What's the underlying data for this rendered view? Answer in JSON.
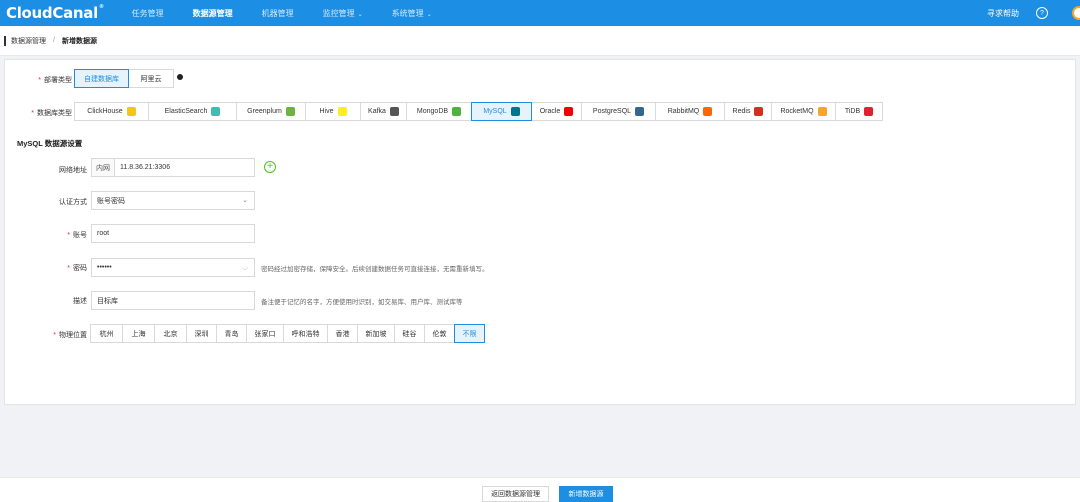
{
  "app": {
    "logo": "CloudCanal",
    "logo_mark": "®"
  },
  "nav": {
    "items": [
      {
        "label": "任务管理",
        "active": false,
        "caret": ""
      },
      {
        "label": "数据源管理",
        "active": true,
        "caret": ""
      },
      {
        "label": "机器管理",
        "active": false,
        "caret": ""
      },
      {
        "label": "监控管理",
        "active": false,
        "caret": "⌄"
      },
      {
        "label": "系统管理",
        "active": false,
        "caret": "⌄"
      }
    ],
    "help": "寻求帮助",
    "help_icon": "?"
  },
  "breadcrumb": {
    "parent": "数据源管理",
    "separator": "/",
    "current": "新增数据源"
  },
  "form": {
    "deploy": {
      "label": "部署类型",
      "options": [
        "自建数据库",
        "阿里云"
      ],
      "selected": "自建数据库"
    },
    "dbtype": {
      "label": "数据库类型",
      "options": [
        {
          "name": "ClickHouse",
          "icon": "clickhouse-icon",
          "color": "#f5c518"
        },
        {
          "name": "ElasticSearch",
          "icon": "elasticsearch-icon",
          "color": "#3ebeb0"
        },
        {
          "name": "Greenplum",
          "icon": "greenplum-icon",
          "color": "#6db33f"
        },
        {
          "name": "Hive",
          "icon": "hive-icon",
          "color": "#fdee21"
        },
        {
          "name": "Kafka",
          "icon": "kafka-icon",
          "color": "#555555"
        },
        {
          "name": "MongoDB",
          "icon": "mongodb-icon",
          "color": "#4db33d"
        },
        {
          "name": "MySQL",
          "icon": "mysql-icon",
          "color": "#00758f"
        },
        {
          "name": "Oracle",
          "icon": "oracle-icon",
          "color": "#f80000"
        },
        {
          "name": "PostgreSQL",
          "icon": "postgresql-icon",
          "color": "#336791"
        },
        {
          "name": "RabbitMQ",
          "icon": "rabbitmq-icon",
          "color": "#ff6600"
        },
        {
          "name": "Redis",
          "icon": "redis-icon",
          "color": "#d82c20"
        },
        {
          "name": "RocketMQ",
          "icon": "rocketmq-icon",
          "color": "#f5a623"
        },
        {
          "name": "TiDB",
          "icon": "tidb-icon",
          "color": "#e3202f"
        }
      ],
      "selected": "MySQL"
    },
    "section_title": "MySQL 数据源设置",
    "network": {
      "label": "网络地址",
      "prefix": "内网",
      "value": "11.8.36.21:3306",
      "add_icon": "+"
    },
    "auth": {
      "label": "认证方式",
      "value": "账号密码",
      "chevron": "⌄"
    },
    "account": {
      "label": "账号",
      "value": "root"
    },
    "password": {
      "label": "密码",
      "value": "••••••",
      "eye_icon": "◡",
      "hint": "密码经过加密存储，保障安全。后续创建数据任务可直接连接，无需重新填写。"
    },
    "desc": {
      "label": "描述",
      "value": "目标库",
      "hint": "备注便于记忆的名字，方便使用时识别，如交易库、用户库、测试库等"
    },
    "region": {
      "label": "物理位置",
      "options": [
        "杭州",
        "上海",
        "北京",
        "深圳",
        "青岛",
        "张家口",
        "呼和浩特",
        "香港",
        "新加坡",
        "硅谷",
        "伦敦",
        "不限"
      ],
      "selected": "不限"
    }
  },
  "footer": {
    "back": "返回数据源管理",
    "submit": "新增数据源"
  },
  "colors": {
    "primary": "#1c8ee3",
    "required": "#f5222d",
    "add": "#52c41a"
  }
}
